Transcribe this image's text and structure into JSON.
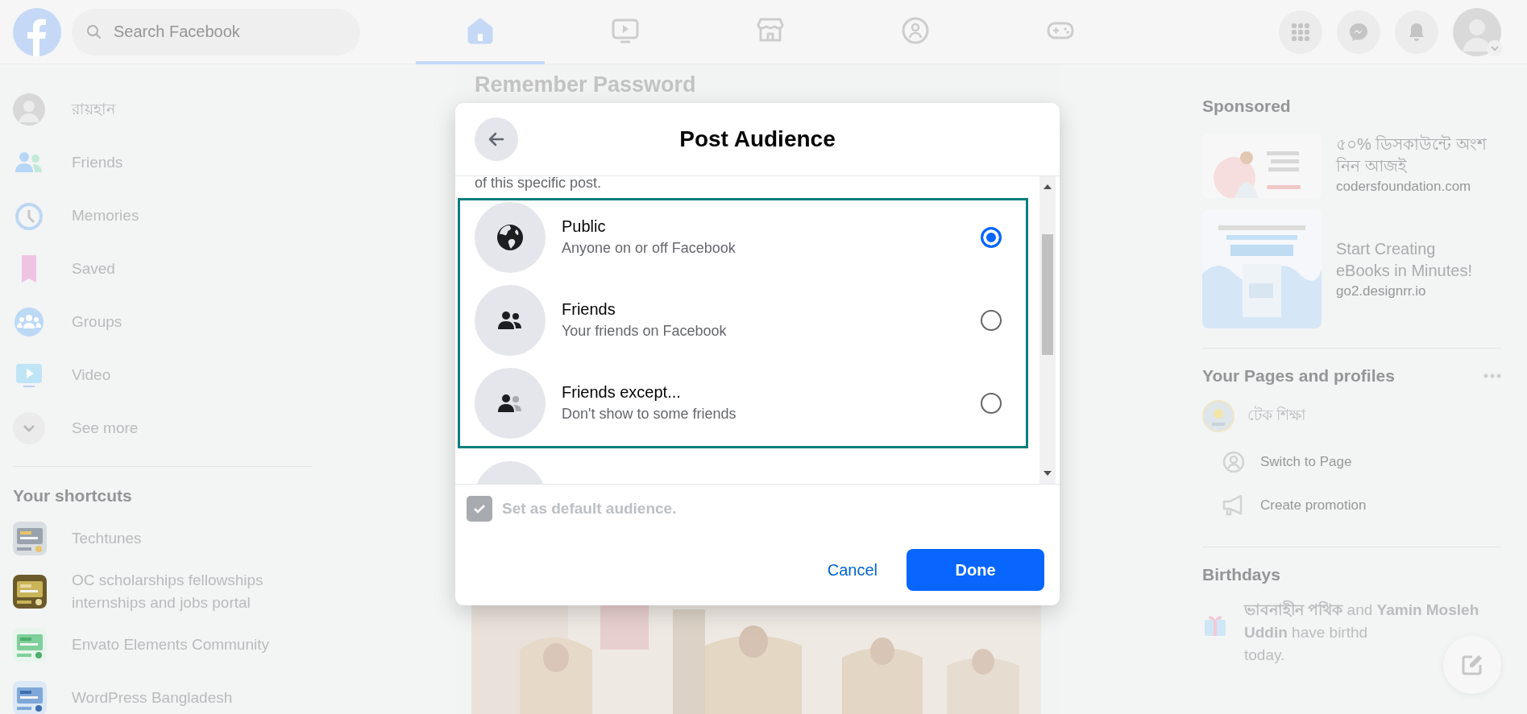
{
  "top_bar": {
    "search": {
      "placeholder": "Search Facebook"
    },
    "nav_tabs": [
      {
        "kind": "home",
        "selected": true
      },
      {
        "kind": "video",
        "selected": false
      },
      {
        "kind": "store",
        "selected": false
      },
      {
        "kind": "groups",
        "selected": false
      },
      {
        "kind": "gaming",
        "selected": false
      }
    ]
  },
  "left_sidebar": {
    "items": [
      {
        "kind": "profile",
        "label": "রায়হান"
      },
      {
        "kind": "friends",
        "label": "Friends"
      },
      {
        "kind": "memories",
        "label": "Memories"
      },
      {
        "kind": "saved",
        "label": "Saved"
      },
      {
        "kind": "groups",
        "label": "Groups"
      },
      {
        "kind": "video",
        "label": "Video"
      },
      {
        "kind": "more",
        "label": "See more"
      }
    ],
    "shortcuts_heading": "Your shortcuts",
    "shortcuts": [
      {
        "label": "Techtunes"
      },
      {
        "label": "OC scholarships fellowships internships and jobs portal"
      },
      {
        "label": "Envato Elements Community"
      },
      {
        "label": "WordPress Bangladesh"
      }
    ]
  },
  "feed": {
    "heading": "Remember Password"
  },
  "dialog": {
    "title": "Post Audience",
    "intro_text": "of this specific post.",
    "options": [
      {
        "kind": "public",
        "title": "Public",
        "description": "Anyone on or off Facebook",
        "selected": true
      },
      {
        "kind": "friends",
        "title": "Friends",
        "description": "Your friends on Facebook",
        "selected": false
      },
      {
        "kind": "friends_except",
        "title": "Friends except...",
        "description": "Don't show to some friends",
        "selected": false
      }
    ],
    "default_checkbox": {
      "label": "Set as default audience.",
      "checked": true,
      "disabled": true
    },
    "buttons": [
      {
        "kind": "link",
        "label": "Cancel"
      },
      {
        "kind": "primary",
        "label": "Done"
      }
    ]
  },
  "right_sidebar": {
    "sponsored_heading": "Sponsored",
    "ads": [
      {
        "title": "৫০% ডিসকাউন্টে অংশ নিন আজই",
        "domain": "codersfoundation.com"
      },
      {
        "title": "Start Creating eBooks in Minutes!",
        "domain": "go2.designrr.io"
      }
    ],
    "pages_heading": "Your Pages and profiles",
    "page": {
      "name": "টেক শিক্ষা",
      "actions": [
        {
          "kind": "switch",
          "label": "Switch to Page"
        },
        {
          "kind": "promote",
          "label": "Create promotion"
        }
      ]
    },
    "birthdays_heading": "Birthdays",
    "birthday_text": "**ভাবনাহীন পথিক** and **Yamin Mosleh Uddin** have birthd",
    "birthday_text_end": "today."
  }
}
